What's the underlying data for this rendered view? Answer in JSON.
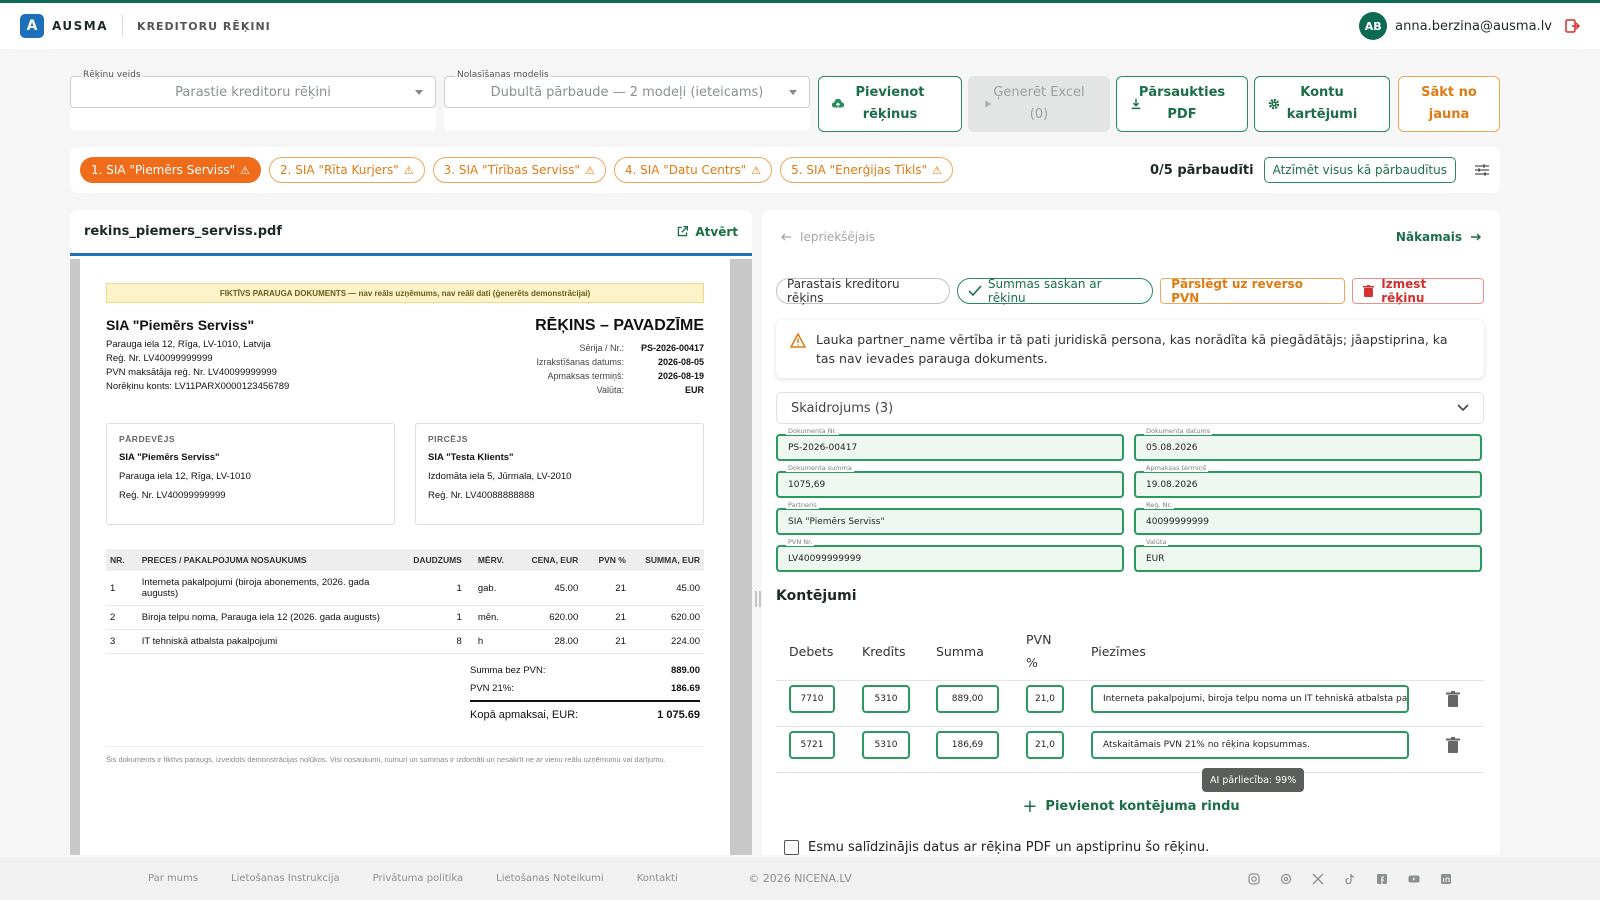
{
  "header": {
    "logo_letter": "A",
    "brand": "AUSMA",
    "title": "KREDITORU RĒĶINI",
    "user_initials": "AB",
    "user_email": "anna.berzina@ausma.lv"
  },
  "controls": {
    "invoice_type": {
      "label": "Rēķinu veids",
      "value": "Parastie kreditoru rēķini"
    },
    "read_model": {
      "label": "Nolasīšanas modelis",
      "value": "Dubultā pārbaude — 2 modeļi (ieteicams)"
    },
    "add_btn": {
      "line1": "Pievienot",
      "line2": "rēķinus"
    },
    "excel_btn": {
      "line1": "Ģenerēt Excel",
      "line2": "(0)"
    },
    "reload_btn": {
      "line1": "Pārsaukties",
      "line2": "PDF"
    },
    "accounts_btn": {
      "line1": "Kontu",
      "line2": "kartējumi"
    },
    "restart_btn": {
      "line1": "Sākt no",
      "line2": "jauna"
    }
  },
  "tabs": [
    {
      "label": "1. SIA \"Piemērs Serviss\""
    },
    {
      "label": "2. SIA \"Rīta Kurjers\""
    },
    {
      "label": "3. SIA \"Tīrības Serviss\""
    },
    {
      "label": "4. SIA \"Datu Centrs\""
    },
    {
      "label": "5. SIA \"Enerģijas Tīkls\""
    }
  ],
  "tabs_warn": "⚠",
  "checked_count": "0/5 pārbaudīti",
  "mark_all": "Atzīmēt visus kā pārbaudītus",
  "pdf": {
    "filename": "rekins_piemers_serviss.pdf",
    "open_label": "Atvērt",
    "banner": "FIKTĪVS PARAUGA DOKUMENTS — nav reāls uzņēmums, nav reāli dati (ģenerēts demonstrācijai)",
    "seller_name": "SIA \"Piemērs Serviss\"",
    "seller_lines": [
      "Parauga iela 12, Rīga, LV-1010, Latvija",
      "Reģ. Nr. LV40099999999",
      "PVN maksātāja reģ. Nr. LV40099999999",
      "Norēķinu konts: LV11PARX0000123456789"
    ],
    "doc_title": "RĒĶINS – PAVADZĪME",
    "meta": [
      {
        "label": "Sērija / Nr.:",
        "value": "PS-2026-00417"
      },
      {
        "label": "Izrakstīšanas datums:",
        "value": "2026-08-05"
      },
      {
        "label": "Apmaksas termiņš:",
        "value": "2026-08-19"
      },
      {
        "label": "Valūta:",
        "value": "EUR"
      }
    ],
    "seller_box": {
      "title": "PĀRDEVĒJS",
      "name": "SIA \"Piemērs Serviss\"",
      "line1": "Parauga iela 12, Rīga, LV-1010",
      "line2": "Reģ. Nr. LV40099999999"
    },
    "buyer_box": {
      "title": "PIRCĒJS",
      "name": "SIA \"Testa Klients\"",
      "line1": "Izdomāta iela 5, Jūrmala, LV-2010",
      "line2": "Reģ. Nr. LV40088888888"
    },
    "table_headers": [
      "NR.",
      "PRECES / PAKALPOJUMA NOSAUKUMS",
      "DAUDZUMS",
      "MĒRV.",
      "CENA, EUR",
      "PVN %",
      "SUMMA, EUR"
    ],
    "rows": [
      [
        "1",
        "Interneta pakalpojumi (biroja abonements, 2026. gada augusts)",
        "1",
        "gab.",
        "45.00",
        "21",
        "45.00"
      ],
      [
        "2",
        "Biroja telpu noma, Parauga iela 12 (2026. gada augusts)",
        "1",
        "mēn.",
        "620.00",
        "21",
        "620.00"
      ],
      [
        "3",
        "IT tehniskā atbalsta pakalpojumi",
        "8",
        "h",
        "28.00",
        "21",
        "224.00"
      ]
    ],
    "totals": [
      {
        "label": "Summa bez PVN:",
        "value": "889.00"
      },
      {
        "label": "PVN 21%:",
        "value": "186.69"
      }
    ],
    "grand_total": {
      "label": "Kopā apmaksai, EUR:",
      "value": "1 075.69"
    },
    "footnote": "Šis dokuments ir fiktīvs paraugs, izveidots demonstrācijas nolūkos. Visi nosaukumi, numuri un summas ir izdomāti un nesakrīt ne ar vienu reālu uzņēmumu vai darījumu."
  },
  "right": {
    "prev": "Iepriekšējais",
    "next": "Nākamais",
    "chip_type": "Parastais kreditoru rēķins",
    "chip_match": "Summas saskan ar rēķinu",
    "chip_reverse": "Pārslēgt uz reverso PVN",
    "chip_delete": "Izmest rēķinu",
    "alert": "Lauka partner_name vērtība ir tā pati juridiskā persona, kas norādīta kā piegādātājs; jāapstiprina, ka tas nav ievades parauga dokuments.",
    "accordion": "Skaidrojums (3)",
    "fields": [
      {
        "label": "Dokumenta Nr.",
        "value": "PS-2026-00417"
      },
      {
        "label": "Dokumenta datums",
        "value": "05.08.2026"
      },
      {
        "label": "Dokumenta summa",
        "value": "1075,69"
      },
      {
        "label": "Apmaksas termiņš",
        "value": "19.08.2026"
      },
      {
        "label": "Partneris",
        "value": "SIA \"Piemērs Serviss\""
      },
      {
        "label": "Reģ. Nr.",
        "value": "40099999999"
      },
      {
        "label": "PVN Nr.",
        "value": "LV40099999999"
      },
      {
        "label": "Valūta",
        "value": "EUR"
      }
    ],
    "section_title": "Kontējumi",
    "kont_headers": {
      "debit": "Debets",
      "credit": "Kredīts",
      "sum": "Summa",
      "vat1": "PVN",
      "vat2": "%",
      "notes": "Piezīmes"
    },
    "kont_rows": [
      {
        "debit": "7710",
        "credit": "5310",
        "sum": "889,00",
        "vat": "21,0",
        "note": "Interneta pakalpojumi, biroja telpu noma un IT tehniskā atbalsta pakalpojumi"
      },
      {
        "debit": "5721",
        "credit": "5310",
        "sum": "186,69",
        "vat": "21,0",
        "note": "Atskaitāmais PVN 21% no rēķina kopsummas."
      }
    ],
    "tooltip": "AI pārliecība: 99%",
    "add_row": "Pievienot kontējuma rindu",
    "confirm": "Esmu salīdzinājis datus ar rēķina PDF un apstiprinu šo rēķinu."
  },
  "footer": {
    "links": [
      "Par mums",
      "Lietošanas Instrukcija",
      "Privātuma politika",
      "Lietošanas Noteikumi",
      "Kontakti"
    ],
    "copyright": "© 2026 NICENA.LV",
    "socials": [
      "instagram-icon",
      "threads-icon",
      "x-icon",
      "tiktok-icon",
      "facebook-icon",
      "youtube-icon",
      "linkedin-icon"
    ]
  },
  "colors": {
    "brand_green": "#0e6b53",
    "accent_orange": "#ef6c1a",
    "field_green": "#2a9a5e",
    "danger": "#d32f2f",
    "pdf_accent": "#1d6fb8"
  }
}
